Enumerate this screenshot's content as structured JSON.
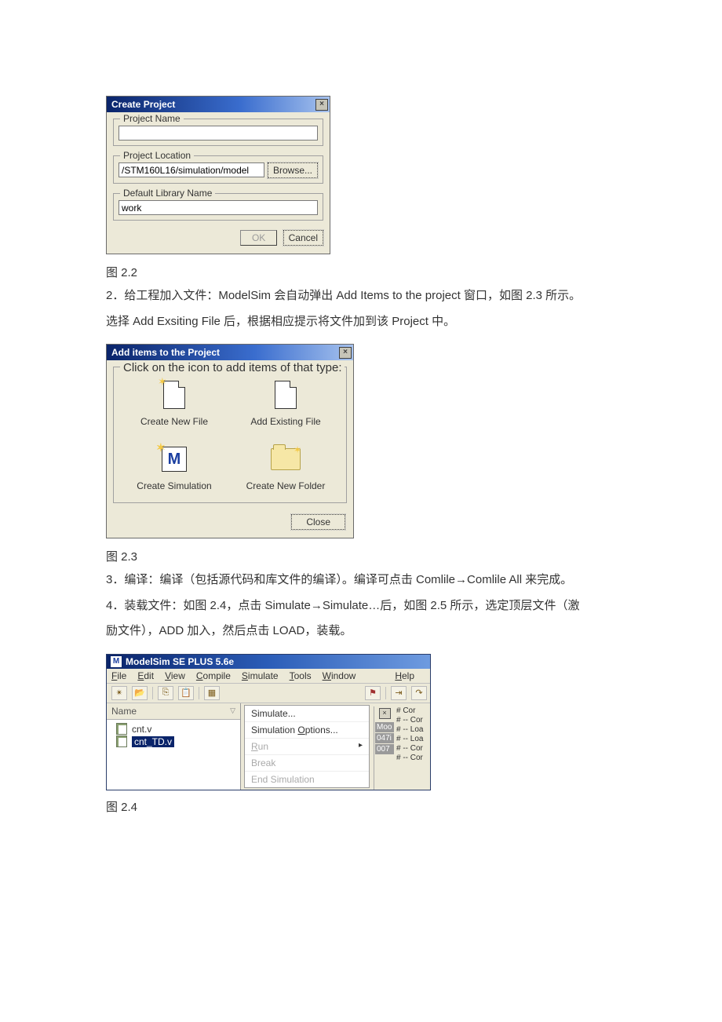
{
  "dlg1": {
    "title": "Create Project",
    "projectName": {
      "legend": "Project Name",
      "value": ""
    },
    "projectLocation": {
      "legend": "Project Location",
      "value": "/STM160L16/simulation/model",
      "browse": "Browse..."
    },
    "defaultLib": {
      "legend": "Default Library Name",
      "value": "work"
    },
    "ok": "OK",
    "cancel": "Cancel"
  },
  "caption1": "图 2.2",
  "para1a": "2．给工程加入文件：ModelSim 会自动弹出 Add Items to the project 窗口，如图 2.3 所示。",
  "para1b": "选择 Add Exsiting File 后，根据相应提示将文件加到该 Project 中。",
  "dlg2": {
    "title": "Add items to the Project",
    "legend": "Click on the icon to add items of that type:",
    "items": {
      "createNewFile": "Create New File",
      "addExistingFile": "Add Existing File",
      "createSimulation": "Create Simulation",
      "createNewFolder": "Create New Folder"
    },
    "close": "Close"
  },
  "caption2": "图 2.3",
  "para3": "3．编译：编译（包括源代码和库文件的编译）。编译可点击 Comlile→Comlile All 来完成。",
  "para4a": "4．装载文件：如图 2.4，点击 Simulate→Simulate…后，如图 2.5 所示，选定顶层文件（激",
  "para4b": "励文件），ADD 加入，然后点击 LOAD，装载。",
  "mswin": {
    "title": "ModelSim SE PLUS 5.6e",
    "menu": {
      "file": "File",
      "edit": "Edit",
      "view": "View",
      "compile": "Compile",
      "simulate": "Simulate",
      "tools": "Tools",
      "window": "Window",
      "help": "Help"
    },
    "sideHeader": "Name",
    "files": {
      "f1": "cnt.v",
      "f2": "cnt_TD.v"
    },
    "dropdown": {
      "simulate": "Simulate...",
      "options": "Simulation Options...",
      "run": "Run",
      "break": "Break",
      "end": "End Simulation"
    },
    "right": {
      "tags": {
        "moo": "Moo",
        "t047": "047i",
        "t007": "007"
      },
      "lines": [
        "#    Cor",
        "# -- Cor",
        "# -- Loa",
        "# -- Loa",
        "# -- Cor",
        "# -- Cor"
      ]
    }
  },
  "caption3": "图 2.4"
}
